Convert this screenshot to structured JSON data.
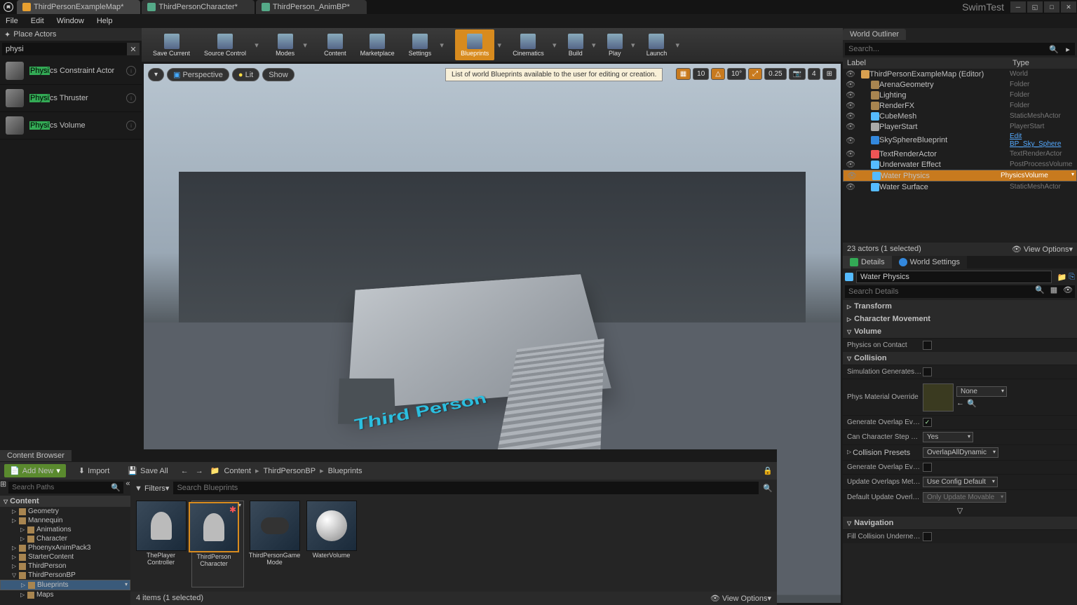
{
  "project_name": "SwimTest",
  "tabs": [
    {
      "label": "ThirdPersonExampleMap*"
    },
    {
      "label": "ThirdPersonCharacter*"
    },
    {
      "label": "ThirdPerson_AnimBP*"
    }
  ],
  "menu": [
    "File",
    "Edit",
    "Window",
    "Help"
  ],
  "place_actors": {
    "title": "Place Actors",
    "search": "physi",
    "items": [
      {
        "pre": "Physi",
        "post": "cs Constraint Actor"
      },
      {
        "pre": "Physi",
        "post": "cs Thruster"
      },
      {
        "pre": "Physi",
        "post": "cs Volume"
      }
    ]
  },
  "toolbar": [
    {
      "label": "Save Current"
    },
    {
      "label": "Source Control",
      "drop": true
    },
    {
      "label": "Modes",
      "drop": true
    },
    {
      "label": "Content"
    },
    {
      "label": "Marketplace"
    },
    {
      "label": "Settings",
      "drop": true
    },
    {
      "label": "Blueprints",
      "drop": true,
      "active": true
    },
    {
      "label": "Cinematics",
      "drop": true
    },
    {
      "label": "Build",
      "drop": true
    },
    {
      "label": "Play",
      "drop": true
    },
    {
      "label": "Launch",
      "drop": true
    }
  ],
  "tooltip": "List of world Blueprints available to the user for editing or creation.",
  "viewport": {
    "perspective": "Perspective",
    "lit": "Lit",
    "show": "Show",
    "snap1": "10",
    "snap2": "10°",
    "snap3": "0.25",
    "snap4": "4",
    "scene_text": "Third Person"
  },
  "outliner": {
    "title": "World Outliner",
    "search_placeholder": "Search...",
    "col1": "Label",
    "col2": "Type",
    "rows": [
      {
        "indent": 0,
        "label": "ThirdPersonExampleMap (Editor)",
        "type": "World",
        "ico": "#d8a050"
      },
      {
        "indent": 1,
        "label": "ArenaGeometry",
        "type": "Folder",
        "ico": "#a88550"
      },
      {
        "indent": 1,
        "label": "Lighting",
        "type": "Folder",
        "ico": "#a88550"
      },
      {
        "indent": 1,
        "label": "RenderFX",
        "type": "Folder",
        "ico": "#a88550"
      },
      {
        "indent": 1,
        "label": "CubeMesh",
        "type": "StaticMeshActor",
        "ico": "#5bf"
      },
      {
        "indent": 1,
        "label": "PlayerStart",
        "type": "PlayerStart",
        "ico": "#aaa"
      },
      {
        "indent": 1,
        "label": "SkySphereBlueprint",
        "type": "Edit BP_Sky_Sphere",
        "link": true,
        "ico": "#38d"
      },
      {
        "indent": 1,
        "label": "TextRenderActor",
        "type": "TextRenderActor",
        "ico": "#e55"
      },
      {
        "indent": 1,
        "label": "Underwater Effect",
        "type": "PostProcessVolume",
        "ico": "#5bf"
      },
      {
        "indent": 1,
        "label": "Water Physics",
        "type": "PhysicsVolume",
        "sel": true,
        "ico": "#5bf"
      },
      {
        "indent": 1,
        "label": "Water Surface",
        "type": "StaticMeshActor",
        "ico": "#5bf"
      }
    ],
    "footer": "23 actors (1 selected)",
    "view_options": "View Options"
  },
  "details": {
    "tab1": "Details",
    "tab2": "World Settings",
    "actor_name": "Water Physics",
    "search_placeholder": "Search Details",
    "cats": {
      "transform": "Transform",
      "char_move": "Character Movement",
      "volume": "Volume",
      "collision": "Collision",
      "navigation": "Navigation"
    },
    "props": {
      "physics_on_contact": "Physics on Contact",
      "sim_hit": "Simulation Generates Hit E",
      "phys_mat": "Phys Material Override",
      "phys_mat_val": "None",
      "gen_overlap": "Generate Overlap Events",
      "can_step": "Can Character Step Up On",
      "can_step_val": "Yes",
      "coll_presets": "Collision Presets",
      "coll_presets_val": "OverlapAllDynamic",
      "gen_overlap_d": "Generate Overlap Events D",
      "update_method": "Update Overlaps Method D",
      "update_method_val": "Use Config Default",
      "default_update": "Default Update Overlaps M",
      "default_update_val": "Only Update Movable",
      "fill_collision": "Fill Collision Underneath fo"
    }
  },
  "content_browser": {
    "title": "Content Browser",
    "add_new": "Add New",
    "import": "Import",
    "save_all": "Save All",
    "breadcrumb": [
      "Content",
      "ThirdPersonBP",
      "Blueprints"
    ],
    "tree_search_placeholder": "Search Paths",
    "tree_root": "Content",
    "tree": [
      {
        "indent": 1,
        "label": "Geometry"
      },
      {
        "indent": 1,
        "label": "Mannequin"
      },
      {
        "indent": 2,
        "label": "Animations"
      },
      {
        "indent": 2,
        "label": "Character"
      },
      {
        "indent": 1,
        "label": "PhoenyxAnimPack3"
      },
      {
        "indent": 1,
        "label": "StarterContent"
      },
      {
        "indent": 1,
        "label": "ThirdPerson"
      },
      {
        "indent": 1,
        "label": "ThirdPersonBP",
        "open": true
      },
      {
        "indent": 2,
        "label": "Blueprints",
        "sel": true
      },
      {
        "indent": 2,
        "label": "Maps"
      }
    ],
    "filters": "Filters",
    "assets_search_placeholder": "Search Blueprints",
    "assets": [
      {
        "label": "ThePlayer Controller",
        "kind": "pawn"
      },
      {
        "label": "ThirdPerson Character",
        "sel": true,
        "dirty": true,
        "kind": "pawn"
      },
      {
        "label": "ThirdPersonGame Mode",
        "kind": "gamepad"
      },
      {
        "label": "WaterVolume",
        "kind": "sphere"
      }
    ],
    "footer": "4 items (1 selected)",
    "view_options": "View Options"
  }
}
